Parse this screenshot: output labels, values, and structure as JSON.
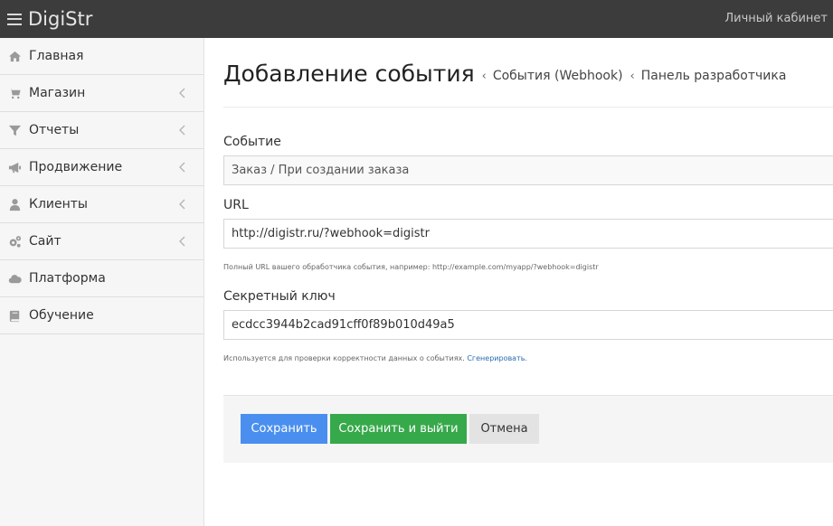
{
  "topbar": {
    "brand": "DigiStr",
    "account_link": "Личный кабинет"
  },
  "sidebar": {
    "items": [
      {
        "label": "Главная",
        "icon": "home-icon",
        "has_submenu": false
      },
      {
        "label": "Магазин",
        "icon": "cart-icon",
        "has_submenu": true
      },
      {
        "label": "Отчеты",
        "icon": "filter-icon",
        "has_submenu": true
      },
      {
        "label": "Продвижение",
        "icon": "megaphone-icon",
        "has_submenu": true
      },
      {
        "label": "Клиенты",
        "icon": "user-icon",
        "has_submenu": true
      },
      {
        "label": "Сайт",
        "icon": "gears-icon",
        "has_submenu": true
      },
      {
        "label": "Платформа",
        "icon": "cloud-icon",
        "has_submenu": false
      },
      {
        "label": "Обучение",
        "icon": "book-icon",
        "has_submenu": false
      }
    ]
  },
  "main": {
    "title": "Добавление события",
    "breadcrumbs": [
      "События (Webhook)",
      "Панель разработчика"
    ],
    "form": {
      "event_label": "Событие",
      "event_value": "Заказ / При создании заказа",
      "url_label": "URL",
      "url_value": "http://digistr.ru/?webhook=digistr",
      "url_help": "Полный URL вашего обработчика события, например: http://example.com/myapp/?webhook=digistr",
      "secret_label": "Секретный ключ",
      "secret_value": "ecdcc3944b2cad91cff0f89b010d49a5",
      "secret_help": "Используется для проверки корректности данных о событиях.",
      "secret_generate_link": "Сгенерировать."
    },
    "buttons": {
      "save": "Сохранить",
      "save_exit": "Сохранить и выйти",
      "cancel": "Отмена"
    }
  },
  "colors": {
    "topbar": "#3c3c3c",
    "save": "#4a8fef",
    "save_exit": "#36a94a",
    "cancel": "#e3e3e3",
    "link": "#2a6bb0"
  }
}
